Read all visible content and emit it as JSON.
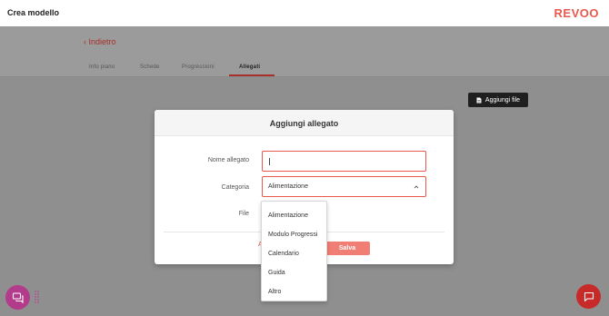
{
  "header": {
    "app_title": "Crea modello",
    "brand": "REVOO"
  },
  "nav": {
    "back_label": "‹ Indietro",
    "tabs": [
      {
        "label": "Info piano",
        "active": false
      },
      {
        "label": "Schede",
        "active": false
      },
      {
        "label": "Progressioni",
        "active": false
      },
      {
        "label": "Allegati",
        "active": true
      }
    ]
  },
  "toolbar": {
    "add_file_label": "Aggiungi file",
    "add_file_icon": "file-icon"
  },
  "modal": {
    "title": "Aggiungi allegato",
    "name_label": "Nome allegato",
    "name_value": "",
    "category_label": "Categoria",
    "category_value": "Alimentazione",
    "file_label": "File",
    "cancel_label": "A",
    "save_label": "Salva"
  },
  "dropdown": {
    "options": [
      "Alimentazione",
      "Modulo Progressi",
      "Calendario",
      "Guida",
      "Altro"
    ]
  },
  "widgets": {
    "chat_left_icon": "chat-icon",
    "chat_right_icon": "message-icon"
  },
  "colors": {
    "accent": "#e8584d",
    "dark_accent": "#a8302c",
    "button_dark": "#1f1f1f",
    "widget_left": "#b33b8c",
    "widget_right": "#c82929"
  }
}
